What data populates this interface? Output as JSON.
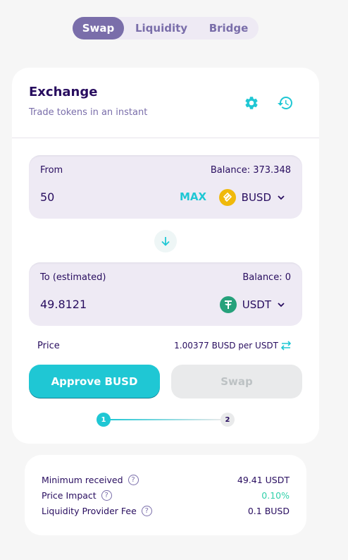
{
  "nav": {
    "tabs": [
      {
        "label": "Swap",
        "active": true
      },
      {
        "label": "Liquidity",
        "active": false
      },
      {
        "label": "Bridge",
        "active": false
      }
    ]
  },
  "exchange": {
    "title": "Exchange",
    "subtitle": "Trade tokens in an instant",
    "icons": {
      "settings": "gear-icon",
      "history": "history-icon"
    }
  },
  "from": {
    "label": "From",
    "balance": "Balance: 373.348",
    "amount": "50",
    "max_label": "MAX",
    "token": "BUSD"
  },
  "to": {
    "label": "To (estimated)",
    "balance": "Balance: 0",
    "amount": "49.8121",
    "token": "USDT"
  },
  "price": {
    "label": "Price",
    "value": "1.00377 BUSD per USDT"
  },
  "actions": {
    "approve_label": "Approve BUSD",
    "swap_label": "Swap"
  },
  "stepper": {
    "step1": "1",
    "step2": "2",
    "current": 1
  },
  "details": [
    {
      "label": "Minimum received",
      "value": "49.41 USDT"
    },
    {
      "label": "Price Impact",
      "value": "0.10%"
    },
    {
      "label": "Liquidity Provider Fee",
      "value": "0.1 BUSD"
    }
  ],
  "colors": {
    "accent": "#1fc7d4",
    "text": "#280d5f",
    "secondary": "#7a6eaa",
    "success": "#31d0aa",
    "busd": "#f0b90b",
    "usdt": "#26a17b"
  }
}
